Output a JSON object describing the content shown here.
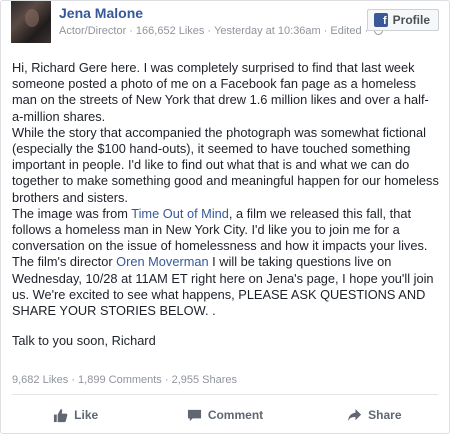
{
  "post": {
    "author": "Jena Malone",
    "role": "Actor/Director",
    "likes": "166,652 Likes",
    "time": "Yesterday at 10:36am",
    "edited": "Edited",
    "profile_label": "Profile",
    "paragraph1": "Hi, Richard Gere here. I was completely surprised to find that last week someone posted a photo of me on a Facebook fan page as a homeless man on the streets of New York that drew 1.6 million likes and over a half-a-million shares.",
    "paragraph2": "While the story that accompanied the photograph was somewhat fictional (especially the $100 hand-outs), it seemed to have touched something important in people. I'd like to find out what that is and what we can do together to make something good and meaningful happen for our homeless brothers and sisters.",
    "paragraph3_a": "The image was from ",
    "paragraph3_link": "Time Out of Mind",
    "paragraph3_b": ", a film we released this fall, that follows a homeless man in New York City. I'd like you to join me for a conversation on the issue of homelessness and how it impacts your lives.",
    "paragraph4_a": "The film's director ",
    "paragraph4_link": "Oren Moverman",
    "paragraph4_b": " I will be taking questions live on Wednesday, 10/28 at 11AM ET right here on Jena's page, I hope you'll join us. We're excited to see what happens, PLEASE ASK QUESTIONS AND SHARE YOUR STORIES BELOW. .",
    "closing": "Talk to you soon, Richard"
  },
  "stats": {
    "likes": "9,682 Likes",
    "comments": "1,899 Comments",
    "shares": "2,955 Shares"
  },
  "actions": {
    "like": "Like",
    "comment": "Comment",
    "share": "Share"
  },
  "icons": [
    "facebook-icon",
    "globe-icon",
    "thumbs-up-icon",
    "comment-icon",
    "share-icon"
  ],
  "colors": {
    "link": "#365899",
    "muted": "#90949c",
    "brand": "#3b5998"
  }
}
